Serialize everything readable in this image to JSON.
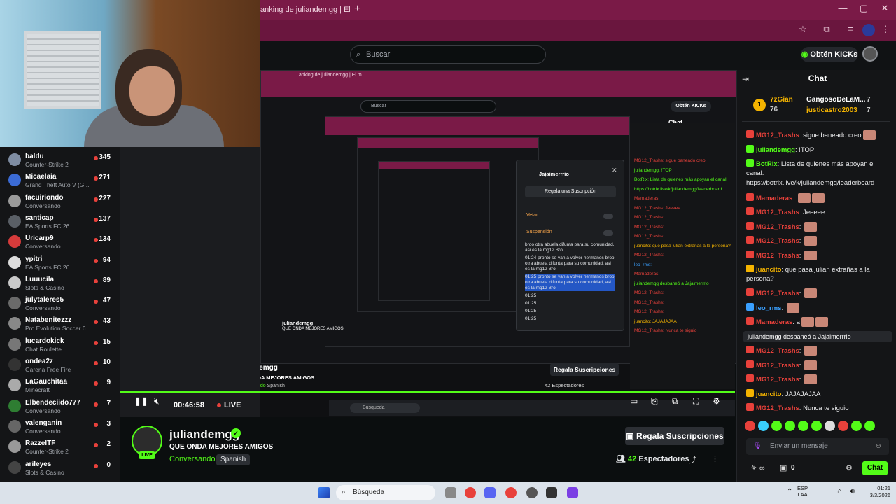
{
  "browser": {
    "tab_title": "anking de juliandemgg | El m",
    "new_tab": "+",
    "minimize": "—",
    "maximize": "▢",
    "close": "✕"
  },
  "header": {
    "search_placeholder": "Buscar",
    "kicks_label": "Obtén KICKs"
  },
  "sidebar": {
    "channels": [
      {
        "name": "baldu",
        "category": "Counter-Strike 2",
        "viewers": "345",
        "color": "#7f8da3"
      },
      {
        "name": "Micaelaia",
        "category": "Grand Theft Auto V (G...",
        "viewers": "271",
        "color": "#3b6bd6"
      },
      {
        "name": "facuiriondo",
        "category": "Conversando",
        "viewers": "227",
        "color": "#9a9a9a"
      },
      {
        "name": "santicap",
        "category": "EA Sports FC 26",
        "viewers": "137",
        "color": "#5a5f66"
      },
      {
        "name": "Uricarp9",
        "category": "Conversando",
        "viewers": "134",
        "color": "#d63b3b"
      },
      {
        "name": "ypitri",
        "category": "EA Sports FC 26",
        "viewers": "94",
        "color": "#ddd"
      },
      {
        "name": "Luuucila",
        "category": "Slots & Casino",
        "viewers": "89",
        "color": "#c9c9c9"
      },
      {
        "name": "julytaleres5",
        "category": "Conversando",
        "viewers": "47",
        "color": "#6a6a6a"
      },
      {
        "name": "Natabenitezzz",
        "category": "Pro Evolution Soccer 6",
        "viewers": "43",
        "color": "#888"
      },
      {
        "name": "lucardokick",
        "category": "Chat Roulette",
        "viewers": "15",
        "color": "#777"
      },
      {
        "name": "ondea2z",
        "category": "Garena Free Fire",
        "viewers": "10",
        "color": "#333"
      },
      {
        "name": "LaGauchitaa",
        "category": "Minecraft",
        "viewers": "9",
        "color": "#aaa"
      },
      {
        "name": "Elbendeciido777",
        "category": "Conversando",
        "viewers": "7",
        "color": "#2e7d32"
      },
      {
        "name": "valenganin",
        "category": "Conversando",
        "viewers": "3",
        "color": "#666"
      },
      {
        "name": "RazzelTF",
        "category": "Counter-Strike 2",
        "viewers": "2",
        "color": "#999"
      },
      {
        "name": "arileyes",
        "category": "Slots & Casino",
        "viewers": "0",
        "color": "#444"
      }
    ]
  },
  "nested": {
    "tab_title": "anking de juliandemgg | El m",
    "search_placeholder": "Buscar",
    "kicks_label": "Obtén KICKs",
    "chat_title": "Chat",
    "popup": {
      "username": "Jajaimerrrio",
      "gift": "Regala una Suscripción",
      "vetar": "Vetar",
      "suspension": "Suspensión",
      "log": [
        "broo otra abuela difunta para su comunidad, asi es la mg12 Bro",
        "01:24 pronto se van a volver hermanos broo otra abuela difunta para su comunidad, asi es la mg12 Bro",
        "01:25 pronto se van a volver hermanos broo otra abuela difunta para su comunidad, asi es la mg12 Bro",
        "01:25",
        "01:25",
        "01:25",
        "01:25"
      ]
    },
    "chat_lines": [
      "MG12_Trashs: sigue baneado creo",
      "juliandemgg: !TOP",
      "BotRix: Lista de quienes más apoyan el canal:",
      "https://botrix.live/k/juliandemgg/leaderboard",
      "Mamaderas:",
      "MG12_Trashs: Jeeeee",
      "MG12_Trashs:",
      "MG12_Trashs:",
      "MG12_Trashs:",
      "juancito: que pasa julian extrañas a la persona?",
      "MG12_Trashs:",
      "leo_rms:",
      "Mamaderas:",
      "juliandemgg desbaneó a Jajaimerrrio",
      "MG12_Trashs:",
      "MG12_Trashs:",
      "MG12_Trashs:",
      "juancito: JAJAJAJAA",
      "MG12_Trashs: Nunca te siguio"
    ],
    "chat_input": "Enviar un mensaje",
    "name": "juliandemgg",
    "title": "QUE ONDA MEJORES AMIGOS",
    "big_name": "juliandemgg",
    "big_title": "QUE ONDA MEJORES AMIGOS",
    "big_category": "Conversando",
    "big_lang": "Spanish",
    "big_gift": "Regala Suscripciones",
    "big_viewers": "42 Espectadores",
    "taskbar_search": "Búsqueda"
  },
  "player": {
    "time": "00:46:58",
    "live": "LIVE",
    "progress": 1.0
  },
  "channel": {
    "name": "juliandemgg",
    "live_badge": "LIVE",
    "title": "QUE ONDA MEJORES AMIGOS",
    "category": "Conversando",
    "language": "Spanish",
    "gift_label": "Regala Suscripciones",
    "viewers_count": "42",
    "viewers_label": "Espectadores"
  },
  "chat": {
    "title": "Chat",
    "pinned": [
      {
        "rank": "1",
        "name": "7zGian",
        "count": "76"
      },
      {
        "name": "GangosoDeLaM...",
        "count": "7"
      },
      {
        "name": "justicastro2003",
        "count": "7"
      }
    ],
    "messages": [
      {
        "user": "MG12_Trashs",
        "text": "sigue baneado creo",
        "color": "#e8413b",
        "emotes": 1
      },
      {
        "user": "juliandemgg",
        "text": "!TOP",
        "color": "#53fc18",
        "emotes": 0
      },
      {
        "user": "BotRix",
        "text": "Lista de quienes más apoyan el canal:",
        "color": "#53fc18",
        "emotes": 0
      },
      {
        "user": "",
        "text": "https://botrix.live/k/juliandemgg/leaderboard",
        "color": "#fff",
        "emotes": 0
      },
      {
        "user": "Mamaderas",
        "text": "",
        "color": "#e8413b",
        "emotes": 2
      },
      {
        "user": "MG12_Trashs",
        "text": "Jeeeee",
        "color": "#e8413b",
        "emotes": 0
      },
      {
        "user": "MG12_Trashs",
        "text": "",
        "color": "#e8413b",
        "emotes": 1
      },
      {
        "user": "MG12_Trashs",
        "text": "",
        "color": "#e8413b",
        "emotes": 1
      },
      {
        "user": "MG12_Trashs",
        "text": "",
        "color": "#e8413b",
        "emotes": 1
      },
      {
        "user": "juancito",
        "text": "que pasa julian extrañas a la persona?",
        "color": "#f5b400",
        "emotes": 0
      },
      {
        "user": "MG12_Trashs",
        "text": "",
        "color": "#e8413b",
        "emotes": 1
      },
      {
        "user": "leo_rms",
        "text": "",
        "color": "#3aa0ff",
        "emotes": 1
      },
      {
        "user": "Mamaderas",
        "text": "a",
        "color": "#e8413b",
        "emotes": 2
      }
    ],
    "ban_notice": "juliandemgg desbaneó a Jajaimerrrio",
    "messages2": [
      {
        "user": "MG12_Trashs",
        "text": "",
        "color": "#e8413b",
        "emotes": 1
      },
      {
        "user": "MG12_Trashs",
        "text": "",
        "color": "#e8413b",
        "emotes": 1
      },
      {
        "user": "MG12_Trashs",
        "text": "",
        "color": "#e8413b",
        "emotes": 1
      },
      {
        "user": "juancito",
        "text": "JAJAJAJAA",
        "color": "#f5b400",
        "emotes": 0
      },
      {
        "user": "MG12_Trashs",
        "text": "Nunca te siguio",
        "color": "#e8413b",
        "emotes": 0
      }
    ],
    "input_placeholder": "Enviar un mensaje",
    "bottom_count": "0",
    "send_label": "Chat"
  },
  "taskbar": {
    "search": "Búsqueda",
    "lang_line1": "ESP",
    "lang_line2": "LAA",
    "time": "01:21",
    "date": "3/3/2026"
  }
}
